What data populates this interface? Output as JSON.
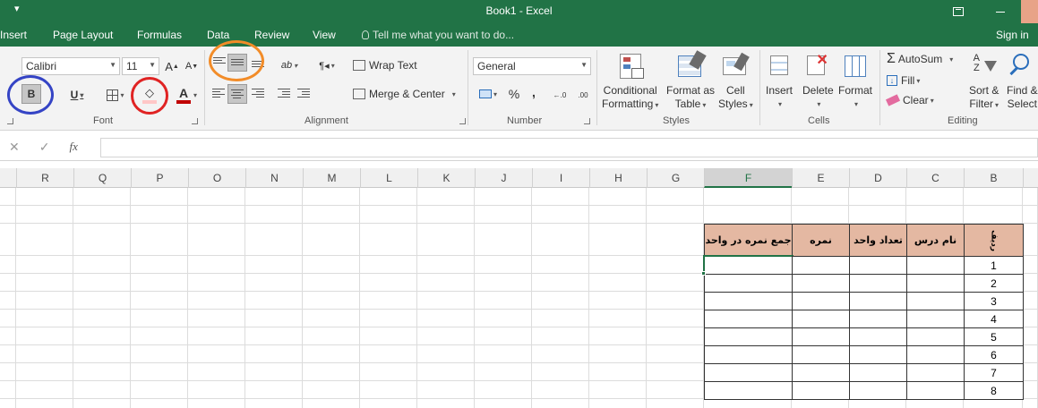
{
  "window": {
    "title": "Book1 - Excel",
    "qat_dropdown": "▾"
  },
  "tabs": [
    {
      "label": "Insert"
    },
    {
      "label": "Page Layout"
    },
    {
      "label": "Formulas"
    },
    {
      "label": "Data"
    },
    {
      "label": "Review"
    },
    {
      "label": "View"
    }
  ],
  "tell_me": "Tell me what you want to do...",
  "sign_in": "Sign in",
  "font_group": {
    "font_name": "Calibri",
    "font_size": "11",
    "grow": "A",
    "shrink": "A",
    "bold": "B",
    "underline": "U",
    "font_color_letter": "A",
    "label": "Font"
  },
  "alignment_group": {
    "wrap_text": "Wrap Text",
    "merge_center": "Merge & Center",
    "orientation": "ab",
    "label": "Alignment"
  },
  "number_group": {
    "format": "General",
    "percent": "%",
    "comma": ",",
    "inc_decimal": "←.0",
    "dec_decimal": ".00",
    "label": "Number"
  },
  "styles_group": {
    "conditional": [
      "Conditional",
      "Formatting"
    ],
    "format_as": [
      "Format as",
      "Table"
    ],
    "cell_styles": [
      "Cell",
      "Styles"
    ],
    "label": "Styles"
  },
  "cells_group": {
    "insert": "Insert",
    "delete": "Delete",
    "format": "Format",
    "label": "Cells"
  },
  "editing_group": {
    "autosum": "AutoSum",
    "fill": "Fill",
    "clear": "Clear",
    "sort": [
      "Sort &",
      "Filter"
    ],
    "find": [
      "Find &",
      "Select"
    ],
    "label": "Editing"
  },
  "formula_bar": {
    "cancel": "✕",
    "enter": "✓",
    "fx": "fx",
    "value": ""
  },
  "columns": [
    "R",
    "Q",
    "P",
    "O",
    "N",
    "M",
    "L",
    "K",
    "J",
    "I",
    "H",
    "G",
    "F",
    "E",
    "D",
    "C",
    "B"
  ],
  "table": {
    "headers": [
      "جمع نمره در واحد",
      "نمره",
      "تعداد واحد",
      "نام درس",
      "ردیف"
    ],
    "row_numbers": [
      "1",
      "2",
      "3",
      "4",
      "5",
      "6",
      "7",
      "8"
    ]
  },
  "colors": {
    "excel_green": "#217346",
    "header_fill": "#e4b8a2",
    "highlight_blue": "#3544c5",
    "highlight_red": "#e02323",
    "highlight_orange": "#f28c28"
  }
}
